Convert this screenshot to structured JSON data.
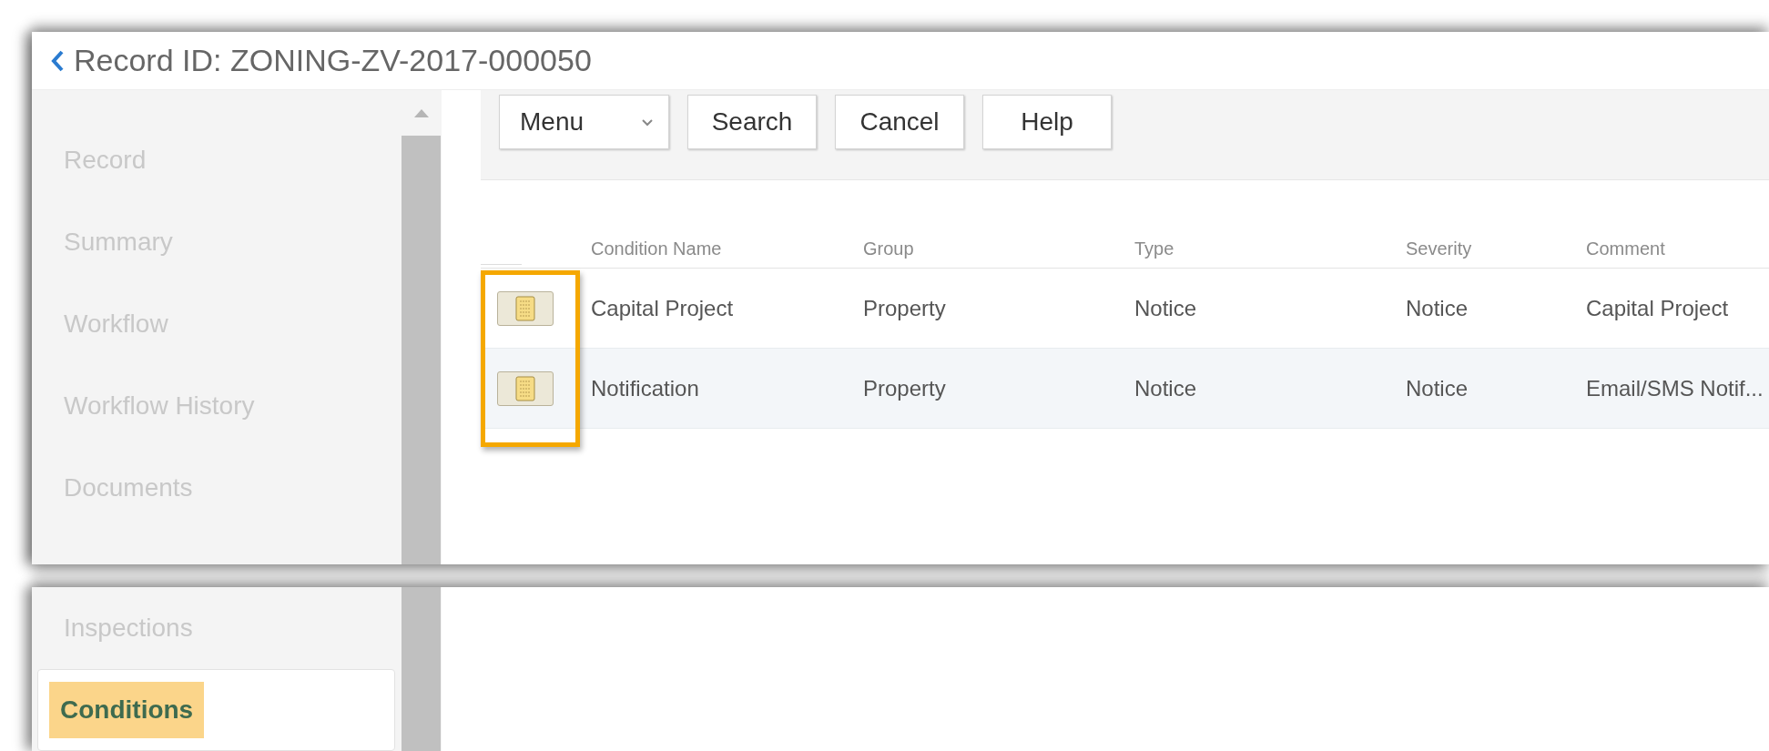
{
  "header": {
    "title": "Record ID: ZONING-ZV-2017-000050"
  },
  "sidebar_upper": {
    "items": [
      {
        "label": "Record",
        "selected": false
      },
      {
        "label": "Summary",
        "selected": false
      },
      {
        "label": "Workflow",
        "selected": false
      },
      {
        "label": "Workflow History",
        "selected": false
      },
      {
        "label": "Documents",
        "selected": false
      }
    ]
  },
  "toolbar": [
    {
      "label": "Menu",
      "kind": "dropdown"
    },
    {
      "label": "Search",
      "kind": "button"
    },
    {
      "label": "Cancel",
      "kind": "button"
    },
    {
      "label": "Help",
      "kind": "button"
    }
  ],
  "table": {
    "columns": [
      "Condition Name",
      "Group",
      "Type",
      "Severity",
      "Comment"
    ],
    "rows": [
      {
        "highlighted": false,
        "cells": [
          "Capital Project",
          "Property",
          "Notice",
          "Notice",
          "Capital Project"
        ]
      },
      {
        "highlighted": true,
        "cells": [
          "Notification",
          "Property",
          "Notice",
          "Notice",
          "Email/SMS Notif..."
        ]
      }
    ]
  },
  "sidebar_lower": {
    "items": [
      {
        "label": "Inspections",
        "selected": false
      },
      {
        "label": "Conditions",
        "selected": true
      }
    ]
  }
}
